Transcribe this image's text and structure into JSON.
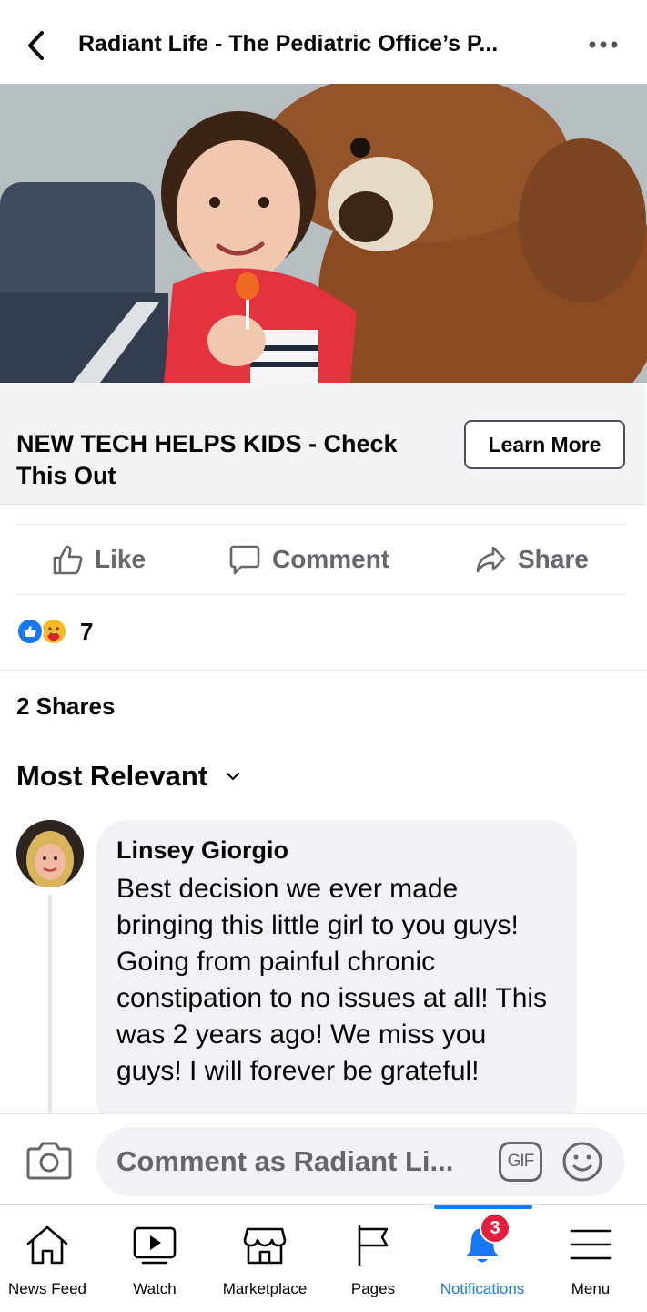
{
  "header": {
    "title": "Radiant Life - The Pediatric Office’s P...",
    "back_icon": "chevron-left-icon",
    "more_icon": "ellipsis-icon"
  },
  "ad": {
    "headline": "NEW TECH HELPS KIDS - Check This Out",
    "cta_label": "Learn More"
  },
  "actions": {
    "like_label": "Like",
    "comment_label": "Comment",
    "share_label": "Share"
  },
  "reactions": {
    "count": "7",
    "types": [
      "like-icon",
      "care-icon"
    ]
  },
  "shares_label": "2 Shares",
  "sort_label": "Most Relevant",
  "comment": {
    "author": "Linsey Giorgio",
    "text": "Best decision we ever made bringing this little girl to you guys! Going from painful chronic constipation to no issues at all! This was 2 years ago! We miss you guys! I will forever be grateful!"
  },
  "composer": {
    "placeholder": "Comment as Radiant Li...",
    "gif_label": "GIF"
  },
  "tabbar": {
    "items": [
      {
        "label": "News Feed",
        "icon": "home-icon"
      },
      {
        "label": "Watch",
        "icon": "watch-icon"
      },
      {
        "label": "Marketplace",
        "icon": "marketplace-icon"
      },
      {
        "label": "Pages",
        "icon": "flag-icon"
      },
      {
        "label": "Notifications",
        "icon": "bell-icon",
        "badge": "3",
        "active": true
      },
      {
        "label": "Menu",
        "icon": "menu-icon"
      }
    ]
  },
  "colors": {
    "accent": "#1877f2",
    "badge": "#e41e3f",
    "secondary_text": "#65676b",
    "bubble": "#f0f2f5"
  }
}
